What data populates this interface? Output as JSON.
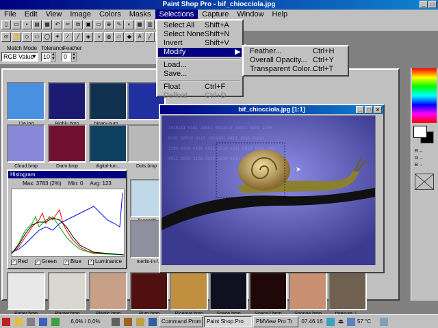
{
  "app": {
    "title": "Paint Shop Pro - bif_chiocciola.jpg"
  },
  "menubar": [
    "File",
    "Edit",
    "View",
    "Image",
    "Colors",
    "Masks",
    "Selections",
    "Capture",
    "Window",
    "Help"
  ],
  "selections_menu": [
    {
      "label": "Select All",
      "shortcut": "Shift+A"
    },
    {
      "label": "Select None",
      "shortcut": "Shift+N"
    },
    {
      "label": "Invert",
      "shortcut": "Shift+V"
    },
    {
      "label": "Modify",
      "shortcut": "▶"
    },
    {
      "label": "Load...",
      "shortcut": ""
    },
    {
      "label": "Save...",
      "shortcut": ""
    },
    {
      "label": "Float",
      "shortcut": "Ctrl+F"
    },
    {
      "label": "Defloat",
      "shortcut": "Ctrl+D"
    }
  ],
  "modify_submenu": [
    {
      "label": "Feather...",
      "shortcut": "Ctrl+H"
    },
    {
      "label": "Overall Opacity...",
      "shortcut": "Ctrl+Y"
    },
    {
      "label": "Transparent Color...",
      "shortcut": "Ctrl+T"
    }
  ],
  "options": {
    "match_mode_label": "Match Mode",
    "match_mode_value": "RGB Value",
    "tolerance_label": "Tolerance",
    "tolerance_value": "10",
    "feather_label": "Feather",
    "feather_value": "0"
  },
  "thumbnails": [
    {
      "label": "11e.jpg",
      "color": "#4a90e0"
    },
    {
      "label": "Bigblu.bmp",
      "color": "#1a1a70"
    },
    {
      "label": "binary-num...",
      "color": "#103050"
    },
    {
      "label": "",
      "color": "#2030a0"
    },
    {
      "label": "Cloud.bmp",
      "color": "#8888d8"
    },
    {
      "label": "Diam.bmp",
      "color": "#701030"
    },
    {
      "label": "digital-tun...",
      "color": "#104060"
    },
    {
      "label": "Dots.bmp",
      "color": "#b8b8b8"
    },
    {
      "label": "il+vecchi...",
      "color": "#c0d8e8"
    },
    {
      "label": "merlin-in-f...",
      "color": "#9090a0"
    },
    {
      "label": "Paper.bmp",
      "color": "#e8e8e8"
    },
    {
      "label": "Plaster.bmp",
      "color": "#d8d8d0"
    },
    {
      "label": "Plastic.bmp",
      "color": "#c8a088"
    },
    {
      "label": "Purp.bmp",
      "color": "#501010"
    },
    {
      "label": "Ricemat.bmp",
      "color": "#c09040"
    },
    {
      "label": "Space.bmp",
      "color": "#101020"
    },
    {
      "label": "Space2.bmp",
      "color": "#200808"
    },
    {
      "label": "Sponge.bmp",
      "color": "#c89070"
    },
    {
      "label": "thresure_j...",
      "color": "#706050"
    }
  ],
  "histogram": {
    "title": "Histogram",
    "max": "Max: 3783 (2%)",
    "min": "Min: 0",
    "avg": "Avg: 123",
    "checks": [
      "Red",
      "Green",
      "Blue",
      "Luminance"
    ]
  },
  "image_window": {
    "title": "bif_chiocciola.jpg [1:1]"
  },
  "palette": {
    "r_label": "R→",
    "g_label": "G→",
    "b_label": "B→"
  },
  "taskbar": {
    "zoom": "6,0% / 0,0%",
    "tasks": [
      "Command Prom",
      "Paint Shop Pro",
      "PMView Pro Tr"
    ],
    "date": "07.46.16",
    "temp": "57 °C"
  }
}
